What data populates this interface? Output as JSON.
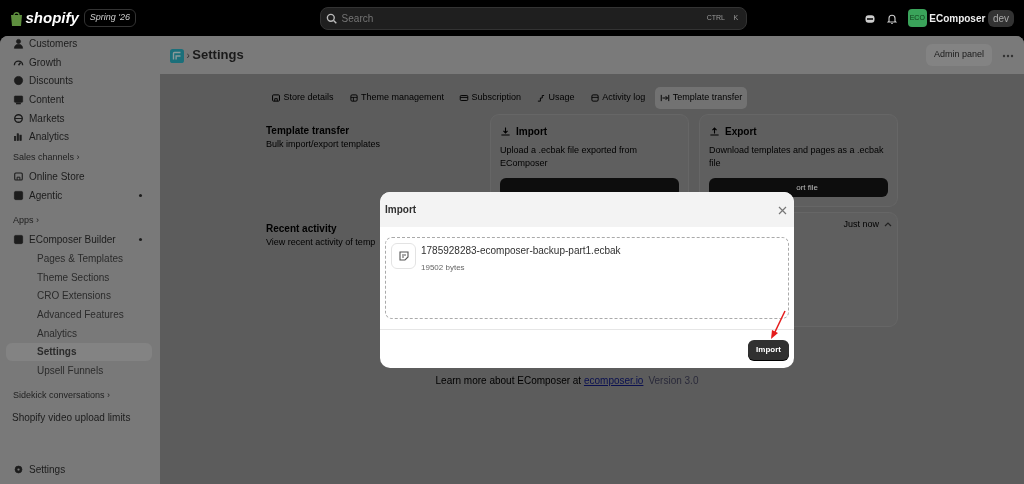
{
  "topbar": {
    "logo": "shopify",
    "edition": "Spring '26",
    "search": {
      "placeholder": "Search",
      "shortcut": [
        "CTRL",
        "K"
      ]
    },
    "store": {
      "avatar": "ECO",
      "name": "EComposer",
      "tag": "dev"
    }
  },
  "sidebar": {
    "items": [
      {
        "kind": "item",
        "label": "Customers",
        "selected": false,
        "dot": false
      },
      {
        "kind": "item",
        "label": "Growth",
        "selected": false,
        "dot": false
      },
      {
        "kind": "item",
        "label": "Discounts",
        "selected": false,
        "dot": false
      },
      {
        "kind": "item",
        "label": "Content",
        "selected": false,
        "dot": false
      },
      {
        "kind": "item",
        "label": "Markets",
        "selected": false,
        "dot": false
      },
      {
        "kind": "item",
        "label": "Analytics",
        "selected": false,
        "dot": false
      },
      {
        "kind": "section",
        "label": "Sales channels ›"
      },
      {
        "kind": "item",
        "label": "Online Store",
        "selected": false,
        "dot": false
      },
      {
        "kind": "item",
        "label": "Agentic",
        "selected": false,
        "dot": true
      },
      {
        "kind": "section",
        "label": "Apps ›"
      },
      {
        "kind": "item",
        "label": "EComposer Builder",
        "selected": false,
        "dot": true,
        "children": [
          {
            "label": "Pages & Templates",
            "selected": false
          },
          {
            "label": "Theme Sections",
            "selected": false
          },
          {
            "label": "CRO Extensions",
            "selected": false
          },
          {
            "label": "Advanced Features",
            "selected": false
          },
          {
            "label": "Analytics",
            "selected": false
          },
          {
            "label": "Settings",
            "selected": true
          },
          {
            "label": "Upsell Funnels",
            "selected": false
          }
        ]
      },
      {
        "kind": "section",
        "label": "Sidekick conversations ›"
      },
      {
        "kind": "plain",
        "label": "Shopify video upload limits"
      }
    ],
    "footer": {
      "label": "Settings"
    }
  },
  "header": {
    "separator": "›",
    "title": "Settings",
    "buttons": [
      "Admin panel"
    ]
  },
  "tabs": [
    {
      "label": "Store details",
      "selected": false
    },
    {
      "label": "Theme management",
      "selected": false
    },
    {
      "label": "Subscription",
      "selected": false
    },
    {
      "label": "Usage",
      "selected": false
    },
    {
      "label": "Activity log",
      "selected": false
    },
    {
      "label": "Template transfer",
      "selected": true
    }
  ],
  "transfer": {
    "title": "Template transfer",
    "subtitle": "Bulk import/export templates",
    "cards": [
      {
        "title": "Import",
        "text": "Upload a .ecbak file exported from EComposer"
      },
      {
        "title": "Export",
        "text": "Download templates and pages as a .ecbak file",
        "button": "ort file"
      }
    ]
  },
  "recent": {
    "title": "Recent activity",
    "subtitle": "View recent activity of temp",
    "time": "Just now",
    "expanded": true
  },
  "footer_note": {
    "text": "Learn more about EComposer at",
    "link": "ecomposer.io",
    "version": "Version 3.0"
  },
  "modal": {
    "title": "Import",
    "file": {
      "name": "1785928283-ecomposer-backup-part1.ecbak",
      "size": "19502 bytes"
    },
    "button": "Import"
  }
}
